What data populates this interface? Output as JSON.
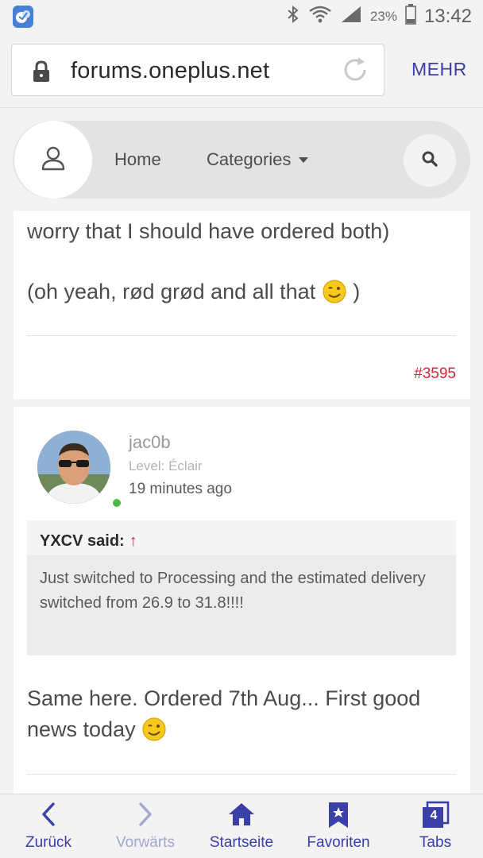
{
  "status_bar": {
    "battery": "23%",
    "time": "13:42"
  },
  "browser": {
    "url": "forums.oneplus.net",
    "more_label": "MEHR"
  },
  "forum_nav": {
    "home": "Home",
    "categories": "Categories"
  },
  "post_previous": {
    "line1": "worry that I should have ordered both)",
    "line2": "(oh yeah, rød grød and all that",
    "line2_end": ")",
    "post_number": "#3595"
  },
  "post_current": {
    "username": "jac0b",
    "level": "Level: Éclair",
    "time": "19 minutes ago",
    "quote": {
      "author": "YXCV said:",
      "arrow": "↑",
      "text": "Just switched to Processing and the estimated delivery switched from 26.9 to 31.8!!!!"
    },
    "body_line1": "Same here. Ordered 7th Aug... First good",
    "body_line2": "news today"
  },
  "bottom_bar": {
    "back": "Zurück",
    "forward": "Vorwärts",
    "home": "Startseite",
    "favorites": "Favoriten",
    "tabs": "Tabs",
    "tabs_count": "4"
  },
  "colors": {
    "accent": "#3b3fa8",
    "post_number": "#d1283a",
    "online": "#4cb848"
  }
}
